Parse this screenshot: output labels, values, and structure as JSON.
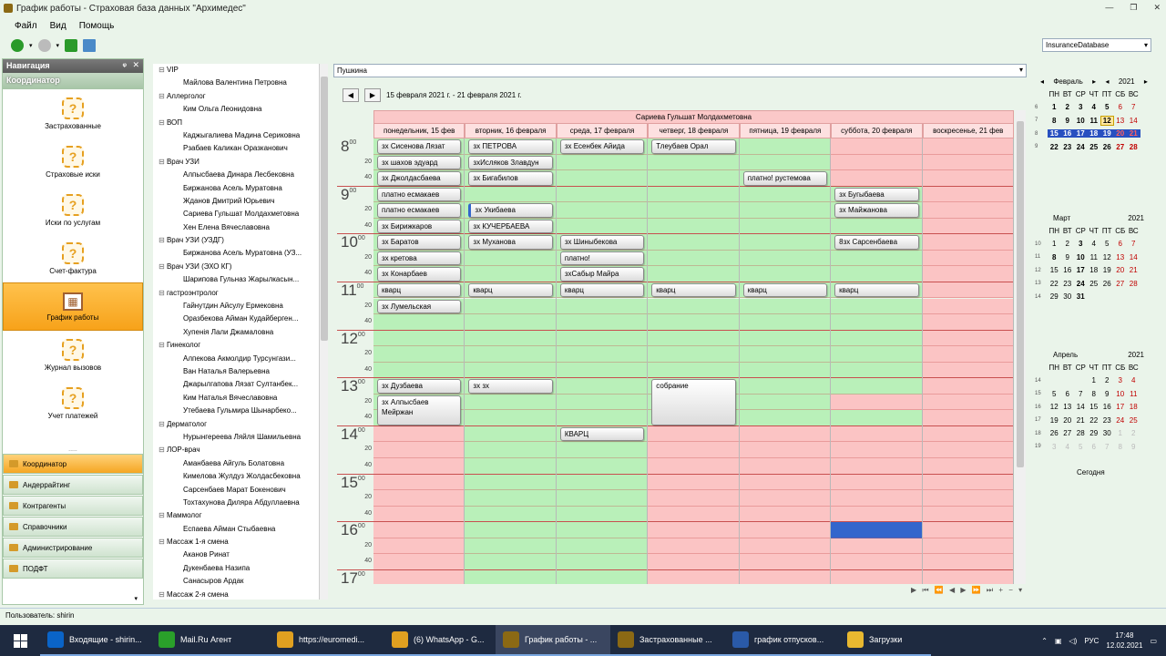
{
  "window": {
    "title": "График работы - Страховая база данных \"Архимедес\""
  },
  "menu": [
    "Файл",
    "Вид",
    "Помощь"
  ],
  "toolbar": {
    "database": "InsuranceDatabase"
  },
  "nav": {
    "title": "Навигация",
    "section": "Координатор",
    "items": [
      {
        "label": "Застрахованные",
        "icon": "question-icon"
      },
      {
        "label": "Страховые иски",
        "icon": "question-icon"
      },
      {
        "label": "Иски по услугам",
        "icon": "question-icon"
      },
      {
        "label": "Счет-фактура",
        "icon": "question-icon"
      },
      {
        "label": "График работы",
        "icon": "grid-icon"
      },
      {
        "label": "Журнал вызовов",
        "icon": "question-icon"
      },
      {
        "label": "Учет платежей",
        "icon": "question-icon"
      }
    ],
    "groups": [
      "Координатор",
      "Андеррайтинг",
      "Контрагенты",
      "Справочники",
      "Администрирование",
      "ПОДФТ"
    ]
  },
  "tree": [
    {
      "g": "VIP",
      "c": [
        "Майлова Валентина Петровна"
      ]
    },
    {
      "g": "Аллерголог",
      "c": [
        "Ким Ольга Леонидовна"
      ]
    },
    {
      "g": "ВОП",
      "c": [
        "Каджыгалиева Мадина Сериковна",
        "Рзабаев Каликан Оразканович"
      ]
    },
    {
      "g": "Врач УЗИ",
      "c": [
        "Алпысбаева Динара Лесбековна",
        "Биржанова Асель Муратовна",
        "Жданов Дмитрий Юрьевич",
        "Сариева Гульшат Молдахметовна",
        "Хен Елена Вячеславовна"
      ]
    },
    {
      "g": "Врач УЗИ (УЗДГ)",
      "c": [
        "Биржанова Асель Муратовна (УЗ..."
      ]
    },
    {
      "g": "Врач УЗИ (ЭХО КГ)",
      "c": [
        "Шарипова Гульназ Жарылкасын..."
      ]
    },
    {
      "g": "гастроэнтролог",
      "c": [
        "Гайнутдин Айсулу Ермековна",
        "Оразбекова Айман Кудайберген...",
        "Хупенія Лали Джамаловна"
      ]
    },
    {
      "g": "Гинеколог",
      "c": [
        "Алпекова Акмолдир Турсунгази...",
        "Ван Наталья Валерьевна",
        "Джарылгапова Лязат Султанбек...",
        "Ким Наталья Вячеславовна",
        "Утебаева Гульмира Шынарбеко..."
      ]
    },
    {
      "g": "Дерматолог",
      "c": [
        "Нурынгереева Ляйля Шамильевна"
      ]
    },
    {
      "g": "ЛОР-врач",
      "c": [
        "Аманбаева Айгуль Болатовна",
        "Кимелова Жулдуз Жолдасбековна",
        "Сарсенбаев Марат Бокенович",
        "Тохтахунова Диляра Абдуллаевна"
      ]
    },
    {
      "g": "Маммолог",
      "c": [
        "Еспаева Айман Стыбаевна"
      ]
    },
    {
      "g": "Массаж 1-я смена",
      "c": [
        "Аканов Ринат",
        "Дукенбаева Назипа",
        "Санасыров Ардак"
      ]
    },
    {
      "g": "Массаж 2-я смена",
      "c": []
    }
  ],
  "schedule": {
    "doctor_filter": "Пушкина",
    "range": "15 февраля 2021 г. - 21 февраля 2021 г.",
    "resource": "Сариева Гульшат Молдахметовна",
    "days": [
      "понедельник, 15 фев",
      "вторник, 16 февраля",
      "среда, 17 февраля",
      "четверг, 18 февраля",
      "пятница, 19 февраля",
      "суббота, 20 февраля",
      "воскресенье, 21 фев"
    ],
    "hours": [
      "8",
      "9",
      "10",
      "11",
      "12",
      "13",
      "14",
      "15",
      "16",
      "17"
    ],
    "minutes": [
      "20",
      "40"
    ],
    "appointments": [
      {
        "d": 0,
        "s": 0,
        "n": 1,
        "t": "зх Сисенова Лязат"
      },
      {
        "d": 0,
        "s": 1,
        "n": 1,
        "t": "зх шахов эдуард"
      },
      {
        "d": 0,
        "s": 2,
        "n": 1,
        "t": "зх Джолдасбаева"
      },
      {
        "d": 0,
        "s": 3,
        "n": 1,
        "t": "платно есмакаев"
      },
      {
        "d": 0,
        "s": 4,
        "n": 1,
        "t": "платно есмакаев"
      },
      {
        "d": 0,
        "s": 5,
        "n": 1,
        "t": "зх Бирижкаров"
      },
      {
        "d": 0,
        "s": 6,
        "n": 1,
        "t": "зх Баратов"
      },
      {
        "d": 0,
        "s": 7,
        "n": 1,
        "t": "зх кретова"
      },
      {
        "d": 0,
        "s": 8,
        "n": 1,
        "t": "зх Конарбаев"
      },
      {
        "d": 0,
        "s": 9,
        "n": 1,
        "t": "кварц"
      },
      {
        "d": 0,
        "s": 10,
        "n": 1,
        "t": "зх Лумельская"
      },
      {
        "d": 0,
        "s": 15,
        "n": 1,
        "t": "зх Дузбаева"
      },
      {
        "d": 0,
        "s": 16,
        "n": 2,
        "t": "зх Алпысбаев Мейржан"
      },
      {
        "d": 1,
        "s": 0,
        "n": 1,
        "t": "зх ПЕТРОВА"
      },
      {
        "d": 1,
        "s": 1,
        "n": 1,
        "t": "зхИсляков Злавдун"
      },
      {
        "d": 1,
        "s": 2,
        "n": 1,
        "t": "зх Бигабилов"
      },
      {
        "d": 1,
        "s": 4,
        "n": 1,
        "t": "зх Укибаева"
      },
      {
        "d": 1,
        "s": 5,
        "n": 1,
        "t": "зх КУЧЕРБАЕВА"
      },
      {
        "d": 1,
        "s": 6,
        "n": 1,
        "t": "зх Муханова"
      },
      {
        "d": 1,
        "s": 9,
        "n": 1,
        "t": "кварц"
      },
      {
        "d": 1,
        "s": 15,
        "n": 1,
        "t": "зх зх"
      },
      {
        "d": 2,
        "s": 0,
        "n": 1,
        "t": "зх Есенбек Айида"
      },
      {
        "d": 2,
        "s": 6,
        "n": 1,
        "t": "зх Шиныбекова"
      },
      {
        "d": 2,
        "s": 7,
        "n": 1,
        "t": "платно!"
      },
      {
        "d": 2,
        "s": 8,
        "n": 1,
        "t": "зхСабыр Майра"
      },
      {
        "d": 2,
        "s": 9,
        "n": 1,
        "t": "кварц"
      },
      {
        "d": 2,
        "s": 18,
        "n": 1,
        "t": "КВАРЦ"
      },
      {
        "d": 3,
        "s": 0,
        "n": 1,
        "t": "Тлеубаев Орал"
      },
      {
        "d": 3,
        "s": 9,
        "n": 1,
        "t": "кварц"
      },
      {
        "d": 3,
        "s": 15,
        "n": 3,
        "t": "собрание"
      },
      {
        "d": 4,
        "s": 2,
        "n": 1,
        "t": "платно! рустемова"
      },
      {
        "d": 4,
        "s": 9,
        "n": 1,
        "t": "кварц"
      },
      {
        "d": 5,
        "s": 3,
        "n": 1,
        "t": "зх Бугыбаева"
      },
      {
        "d": 5,
        "s": 4,
        "n": 1,
        "t": "зх Майжанова"
      },
      {
        "d": 5,
        "s": 6,
        "n": 1,
        "t": "8зх Сарсенбаева"
      },
      {
        "d": 5,
        "s": 9,
        "n": 1,
        "t": "кварц"
      }
    ]
  },
  "calendar": {
    "weekdays": [
      "ПН",
      "ВТ",
      "СР",
      "ЧТ",
      "ПТ",
      "СБ",
      "ВС"
    ],
    "today_label": "Сегодня",
    "months": [
      {
        "name": "Февраль",
        "year": "2021",
        "weeks": [
          [
            "6",
            "1",
            "2",
            "3",
            "4",
            "5",
            "6",
            "7"
          ],
          [
            "7",
            "8",
            "9",
            "10",
            "11",
            "12",
            "13",
            "14"
          ],
          [
            "8",
            "15",
            "16",
            "17",
            "18",
            "19",
            "20",
            "21"
          ],
          [
            "9",
            "22",
            "23",
            "24",
            "25",
            "26",
            "27",
            "28"
          ]
        ]
      },
      {
        "name": "Март",
        "year": "2021",
        "weeks": [
          [
            "10",
            "1",
            "2",
            "3",
            "4",
            "5",
            "6",
            "7"
          ],
          [
            "11",
            "8",
            "9",
            "10",
            "11",
            "12",
            "13",
            "14"
          ],
          [
            "12",
            "15",
            "16",
            "17",
            "18",
            "19",
            "20",
            "21"
          ],
          [
            "13",
            "22",
            "23",
            "24",
            "25",
            "26",
            "27",
            "28"
          ],
          [
            "14",
            "29",
            "30",
            "31",
            "",
            "",
            "",
            ""
          ]
        ]
      },
      {
        "name": "Апрель",
        "year": "2021",
        "weeks": [
          [
            "14",
            "",
            "",
            "",
            "1",
            "2",
            "3",
            "4"
          ],
          [
            "15",
            "5",
            "6",
            "7",
            "8",
            "9",
            "10",
            "11"
          ],
          [
            "16",
            "12",
            "13",
            "14",
            "15",
            "16",
            "17",
            "18"
          ],
          [
            "17",
            "19",
            "20",
            "21",
            "22",
            "23",
            "24",
            "25"
          ],
          [
            "18",
            "26",
            "27",
            "28",
            "29",
            "30",
            "1",
            "2"
          ],
          [
            "19",
            "3",
            "4",
            "5",
            "6",
            "7",
            "8",
            "9"
          ]
        ]
      }
    ]
  },
  "status": {
    "user": "Пользователь: shirin"
  },
  "taskbar": {
    "apps": [
      {
        "label": "Входящие - shirin...",
        "color": "#0a64c8"
      },
      {
        "label": "Mail.Ru Агент",
        "color": "#2aa02a"
      },
      {
        "label": "https://euromedi...",
        "color": "#e0a020"
      },
      {
        "label": "(6) WhatsApp - G...",
        "color": "#e0a020"
      },
      {
        "label": "График работы - ...",
        "color": "#8b6914"
      },
      {
        "label": "Застрахованные ...",
        "color": "#8b6914"
      },
      {
        "label": "график отпусков...",
        "color": "#2a5aa8"
      },
      {
        "label": "Загрузки",
        "color": "#e8b830"
      }
    ],
    "lang": "РУС",
    "time": "17:48",
    "date": "12.02.2021"
  }
}
